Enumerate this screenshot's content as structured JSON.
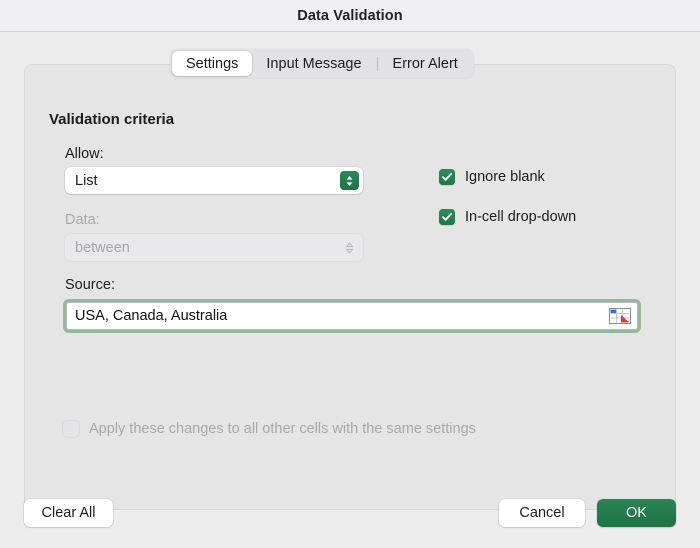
{
  "window": {
    "title": "Data Validation"
  },
  "tabs": [
    {
      "label": "Settings",
      "selected": true
    },
    {
      "label": "Input Message",
      "selected": false
    },
    {
      "label": "Error Alert",
      "selected": false
    }
  ],
  "tab_labels": {
    "settings": "Settings",
    "input_message": "Input Message",
    "error_alert": "Error Alert"
  },
  "settings": {
    "section_title": "Validation criteria",
    "allow": {
      "label": "Allow:",
      "value": "List",
      "enabled": true,
      "icon": "stepper-updown-icon"
    },
    "data": {
      "label": "Data:",
      "value": "between",
      "enabled": false,
      "icon": "stepper-updown-icon"
    },
    "source": {
      "label": "Source:",
      "value": "USA, Canada, Australia",
      "placeholder": "",
      "focused": true,
      "icon": "range-selector-icon"
    },
    "options": [
      {
        "label": "Ignore blank",
        "checked": true,
        "enabled": true
      },
      {
        "label": "In-cell drop-down",
        "checked": true,
        "enabled": true
      }
    ],
    "apply_all": {
      "label": "Apply these changes to all other cells with the same settings",
      "checked": false,
      "enabled": false
    }
  },
  "footer": {
    "clear_all": "Clear All",
    "cancel": "Cancel",
    "ok": "OK"
  },
  "colors": {
    "accent_green": "#1f7346",
    "focus_ring": "#93b89c",
    "dialog_bg": "#ececec",
    "panel_bg": "#e6e5e6",
    "titlebar_bg": "#f0eff2"
  }
}
